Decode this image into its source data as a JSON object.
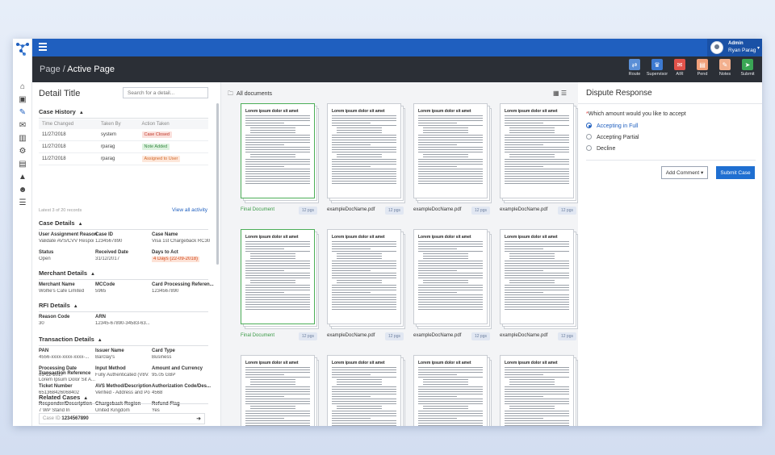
{
  "user": {
    "role": "Admin",
    "name": "Ryan Parag"
  },
  "breadcrumb": {
    "parent": "Page",
    "separator": "/",
    "current": "Active Page"
  },
  "actions": [
    {
      "label": "Route",
      "icon": "route-icon",
      "color": "#5b8fd6",
      "glyph": "⇄"
    },
    {
      "label": "Supervisor",
      "icon": "supervisor-icon",
      "color": "#3d7ad1",
      "glyph": "♛"
    },
    {
      "label": "AIR",
      "icon": "air-icon",
      "color": "#e0524a",
      "glyph": "✉"
    },
    {
      "label": "Pend",
      "icon": "pend-icon",
      "color": "#f0a07a",
      "glyph": "▤"
    },
    {
      "label": "Notes",
      "icon": "notes-icon",
      "color": "#f2b08e",
      "glyph": "✎"
    },
    {
      "label": "Submit",
      "icon": "submit-icon",
      "color": "#3aa655",
      "glyph": "➤"
    }
  ],
  "detail": {
    "title": "Detail Title",
    "search_placeholder": "Search for a detail...",
    "case_history": {
      "title": "Case History",
      "headers": [
        "Time Changed",
        "Taken By",
        "Action Taken"
      ],
      "rows": [
        {
          "time": "11/27/2018",
          "by": "system",
          "action": "Case Closed"
        },
        {
          "time": "11/27/2018",
          "by": "rparag",
          "action": "Note Added"
        },
        {
          "time": "11/27/2018",
          "by": "rparag",
          "action": "Assigned to User"
        }
      ],
      "latest": "Latest 3 of 20 records",
      "view_all": "View all activity"
    },
    "case_details": {
      "title": "Case Details",
      "f1k": "User Assignment Reason",
      "f1v": "Validate AVS/CVV Respon...",
      "f2k": "Case ID",
      "f2v": "1234567890",
      "f3k": "Case Name",
      "f3v": "Visa 1st Chargeback RC30",
      "f4k": "Status",
      "f4v": "Open",
      "f5k": "Received Date",
      "f5v": "31/12/2017",
      "f6k": "Days to Act",
      "f6v": "4 Days (22-09-2018)"
    },
    "merchant": {
      "title": "Merchant Details",
      "f1k": "Merchant Name",
      "f1v": "Wolfie's Cafe Limited",
      "f2k": "MCCode",
      "f2v": "5965",
      "f3k": "Card Processing Referen...",
      "f3v": "1234567890"
    },
    "rfi": {
      "title": "RFI Details",
      "f1k": "Reason Code",
      "f1v": "30",
      "f2k": "ARN",
      "f2v": "12345-67890-34583-63..."
    },
    "transaction": {
      "title": "Transaction Details",
      "f1k": "PAN",
      "f1v": "4556-xxxx-xxxx-xxxx-...",
      "f2k": "Issuer Name",
      "f2v": "Barclay's",
      "f3k": "Card Type",
      "f3v": "Business",
      "f4k": "Processing Date",
      "f4v": "01-12-2017",
      "f5k": "Input Method",
      "f5v": "Fully Authenticated (V8V...",
      "f6k": "Amount and Currency",
      "f6v": "95.05 GBP",
      "f7k": "Ticket Number",
      "f7v": "651368426068402",
      "f8k": "AVS Method/Description",
      "f8v": "Verified - Address and Po...",
      "f9k": "Authorization Code/Des...",
      "f9v": "4568",
      "f10k": "Responder/Description",
      "f10v": "7 WP Stand In",
      "f11k": "Chargeback Region",
      "f11v": "United Kingdom",
      "f12k": "Refund Flag",
      "f12v": "Yes",
      "f13k": "Transaction Reference",
      "f13v": "Lorem Ipsum Dolor Sit A..."
    },
    "related": {
      "title": "Related Cases",
      "case_label": "Case ID",
      "case_value": "1234567890"
    }
  },
  "documents": {
    "title": "All documents",
    "page_heading": "Lorem ipsum dolor sit amet",
    "items": [
      {
        "name": "Final Document",
        "pages": "12 pgs"
      },
      {
        "name": "exampleDocName.pdf",
        "pages": "12 pgs"
      },
      {
        "name": "exampleDocName.pdf",
        "pages": "12 pgs"
      },
      {
        "name": "exampleDocName.pdf",
        "pages": "12 pgs"
      },
      {
        "name": "Final Document",
        "pages": "12 pgs"
      },
      {
        "name": "exampleDocName.pdf",
        "pages": "12 pgs"
      },
      {
        "name": "exampleDocName.pdf",
        "pages": "12 pgs"
      },
      {
        "name": "exampleDocName.pdf",
        "pages": "12 pgs"
      },
      {
        "name": "",
        "pages": ""
      },
      {
        "name": "",
        "pages": ""
      },
      {
        "name": "",
        "pages": ""
      },
      {
        "name": "",
        "pages": ""
      }
    ]
  },
  "dispute": {
    "title": "Dispute Response",
    "question_req": "*",
    "question": "Which amount would you like to accept",
    "options": [
      "Accepting in Full",
      "Accepting Partial",
      "Decline"
    ],
    "selected": 0,
    "add_comment": "Add Comment",
    "submit": "Submit Case"
  },
  "colors": {
    "primary": "#1f5fbf",
    "header": "#2b2f36",
    "final": "#3a9a46"
  }
}
